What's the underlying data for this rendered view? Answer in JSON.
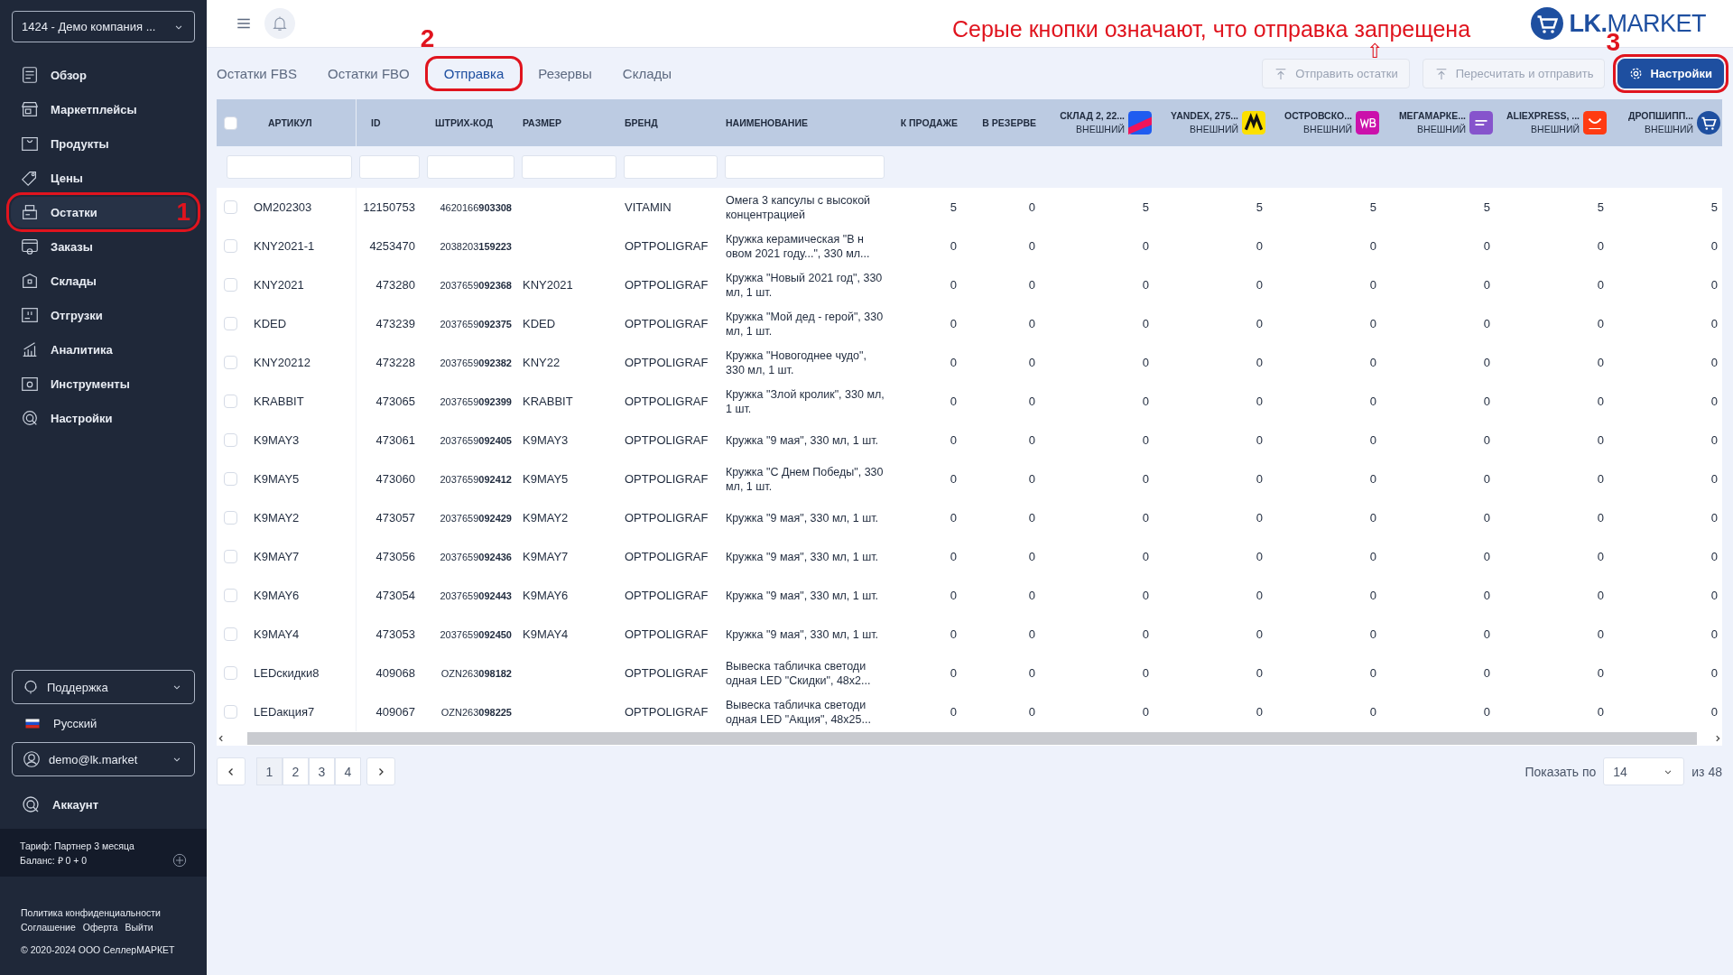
{
  "sidebar": {
    "company_select": "1424 - Демо компания ...",
    "nav": [
      {
        "label": "Обзор",
        "selected": false
      },
      {
        "label": "Маркетплейсы",
        "selected": false
      },
      {
        "label": "Продукты",
        "selected": false
      },
      {
        "label": "Цены",
        "selected": false
      },
      {
        "label": "Остатки",
        "selected": true,
        "callout": "1"
      },
      {
        "label": "Заказы",
        "selected": false
      },
      {
        "label": "Склады",
        "selected": false
      },
      {
        "label": "Отгрузки",
        "selected": false
      },
      {
        "label": "Аналитика",
        "selected": false
      },
      {
        "label": "Инструменты",
        "selected": false
      },
      {
        "label": "Настройки",
        "selected": false
      }
    ],
    "support": "Поддержка",
    "language": "Русский",
    "user": "demo@lk.market",
    "account": "Аккаунт",
    "tariff": "Тариф: Партнер 3 месяца",
    "balance": "Баланс: ₽ 0 + 0",
    "footer_links": [
      "Политика конфиденциальности",
      "Соглашение",
      "Оферта",
      "Выйти"
    ],
    "copyright": "© 2020-2024 ООО СеллерМАРКЕТ"
  },
  "header": {
    "annotation": "Серые кнопки означают, что отправка запрещена",
    "annotation_arrow": "⇧",
    "logo": "**LK.**MARKET"
  },
  "tabs": [
    {
      "label": "Остатки FBS",
      "selected": false
    },
    {
      "label": "Остатки FBO",
      "selected": false
    },
    {
      "label": "Отправка",
      "selected": true,
      "callout": "2"
    },
    {
      "label": "Резервы",
      "selected": false
    },
    {
      "label": "Склады",
      "selected": false
    }
  ],
  "actions": [
    {
      "label": "Отправить остатки",
      "disabled": true
    },
    {
      "label": "Пересчитать и отправить",
      "disabled": true
    },
    {
      "label": "Настройки",
      "disabled": false,
      "callout": "3"
    }
  ],
  "table": {
    "select_all": {
      "checked": false
    },
    "columns": [
      "АРТИКУЛ",
      "ID",
      "ШТРИХ-КОД",
      "РАЗМЕР",
      "БРЕНД",
      "НАИМЕНОВАНИЕ",
      "К ПРОДАЖЕ",
      "В РЕЗЕРВЕ"
    ],
    "marketplaces": [
      {
        "name": "СКЛАД 2, 22...",
        "type": "ВНЕШНИЙ"
      },
      {
        "name": "YANDEX, 275...",
        "type": "ВНЕШНИЙ"
      },
      {
        "name": "ОСТРОВСКО...",
        "type": "ВНЕШНИЙ"
      },
      {
        "name": "МЕГАМАРКЕ...",
        "type": "ВНЕШНИЙ"
      },
      {
        "name": "ALIEXPRESS, ...",
        "type": "ВНЕШНИЙ"
      },
      {
        "name": "ДРОПШИПП...",
        "type": "ВНЕШНИЙ"
      }
    ],
    "rows": [
      {
        "checked": false,
        "article": "OM202303",
        "id": "12150753",
        "barcode": "4620166**903308**",
        "brand": "VITAMIN",
        "name": "Омега 3 капсулы с высокой концентрацией",
        "for_sale": "5",
        "reserved": "0",
        "stock": [
          "5",
          "5",
          "5",
          "5",
          "5",
          "5"
        ]
      },
      {
        "checked": false,
        "article": "KNY2021-1",
        "id": "4253470",
        "barcode": "2038203**159223**",
        "brand": "OPTPOLIGRAF",
        "name": "Кружка керамическая \"В н овом 2021 году...\", 330 мл...",
        "for_sale": "0",
        "reserved": "0",
        "stock": [
          "0",
          "0",
          "0",
          "0",
          "0",
          "0"
        ]
      },
      {
        "checked": false,
        "article": "KNY2021",
        "id": "473280",
        "barcode": "2037659**092368**",
        "size": "KNY2021",
        "brand": "OPTPOLIGRAF",
        "name": "Кружка \"Новый 2021 год\", 330 мл, 1 шт.",
        "for_sale": "0",
        "reserved": "0",
        "stock": [
          "0",
          "0",
          "0",
          "0",
          "0",
          "0"
        ]
      },
      {
        "checked": false,
        "article": "KDED",
        "id": "473239",
        "barcode": "2037659**092375**",
        "size": "KDED",
        "brand": "OPTPOLIGRAF",
        "name": "Кружка \"Мой дед - герой\", 330 мл, 1 шт.",
        "for_sale": "0",
        "reserved": "0",
        "stock": [
          "0",
          "0",
          "0",
          "0",
          "0",
          "0"
        ]
      },
      {
        "checked": false,
        "article": "KNY20212",
        "id": "473228",
        "barcode": "2037659**092382**",
        "size": "KNY22",
        "brand": "OPTPOLIGRAF",
        "name": "Кружка \"Новогоднее чудо\", 330 мл, 1 шт.",
        "for_sale": "0",
        "reserved": "0",
        "stock": [
          "0",
          "0",
          "0",
          "0",
          "0",
          "0"
        ]
      },
      {
        "checked": false,
        "article": "KRABBIT",
        "id": "473065",
        "barcode": "2037659**092399**",
        "size": "KRABBIT",
        "brand": "OPTPOLIGRAF",
        "name": "Кружка \"Злой кролик\", 330 мл, 1 шт.",
        "for_sale": "0",
        "reserved": "0",
        "stock": [
          "0",
          "0",
          "0",
          "0",
          "0",
          "0"
        ]
      },
      {
        "checked": false,
        "article": "K9MAY3",
        "id": "473061",
        "barcode": "2037659**092405**",
        "size": "K9MAY3",
        "brand": "OPTPOLIGRAF",
        "name": "Кружка \"9 мая\", 330 мл, 1 шт.",
        "for_sale": "0",
        "reserved": "0",
        "stock": [
          "0",
          "0",
          "0",
          "0",
          "0",
          "0"
        ]
      },
      {
        "checked": false,
        "article": "K9MAY5",
        "id": "473060",
        "barcode": "2037659**092412**",
        "size": "K9MAY5",
        "brand": "OPTPOLIGRAF",
        "name": "Кружка \"С Днем Победы\", 330 мл, 1 шт.",
        "for_sale": "0",
        "reserved": "0",
        "stock": [
          "0",
          "0",
          "0",
          "0",
          "0",
          "0"
        ]
      },
      {
        "checked": false,
        "article": "K9MAY2",
        "id": "473057",
        "barcode": "2037659**092429**",
        "size": "K9MAY2",
        "brand": "OPTPOLIGRAF",
        "name": "Кружка \"9 мая\", 330 мл, 1 шт.",
        "for_sale": "0",
        "reserved": "0",
        "stock": [
          "0",
          "0",
          "0",
          "0",
          "0",
          "0"
        ]
      },
      {
        "checked": false,
        "article": "K9MAY7",
        "id": "473056",
        "barcode": "2037659**092436**",
        "size": "K9MAY7",
        "brand": "OPTPOLIGRAF",
        "name": "Кружка \"9 мая\", 330 мл, 1 шт.",
        "for_sale": "0",
        "reserved": "0",
        "stock": [
          "0",
          "0",
          "0",
          "0",
          "0",
          "0"
        ]
      },
      {
        "checked": false,
        "article": "K9MAY6",
        "id": "473054",
        "barcode": "2037659**092443**",
        "size": "K9MAY6",
        "brand": "OPTPOLIGRAF",
        "name": "Кружка \"9 мая\", 330 мл, 1 шт.",
        "for_sale": "0",
        "reserved": "0",
        "stock": [
          "0",
          "0",
          "0",
          "0",
          "0",
          "0"
        ]
      },
      {
        "checked": false,
        "article": "K9MAY4",
        "id": "473053",
        "barcode": "2037659**092450**",
        "size": "K9MAY4",
        "brand": "OPTPOLIGRAF",
        "name": "Кружка \"9 мая\", 330 мл, 1 шт.",
        "for_sale": "0",
        "reserved": "0",
        "stock": [
          "0",
          "0",
          "0",
          "0",
          "0",
          "0"
        ]
      },
      {
        "checked": false,
        "article": "LEDскидки8",
        "id": "409068",
        "barcode": "OZN263**098182**",
        "brand": "OPTPOLIGRAF",
        "name": "Вывеска табличка светоди одная LED \"Скидки\", 48x2...",
        "for_sale": "0",
        "reserved": "0",
        "stock": [
          "0",
          "0",
          "0",
          "0",
          "0",
          "0"
        ]
      },
      {
        "checked": false,
        "article": "LEDакция7",
        "id": "409067",
        "barcode": "OZN263**098225**",
        "brand": "OPTPOLIGRAF",
        "name": "Вывеска табличка светоди одная LED \"Акция\", 48x25...",
        "for_sale": "0",
        "reserved": "0",
        "stock": [
          "0",
          "0",
          "0",
          "0",
          "0",
          "0"
        ]
      }
    ]
  },
  "pagination": {
    "pages": [
      {
        "label": "1",
        "selected": true
      },
      {
        "label": "2",
        "selected": false
      },
      {
        "label": "3",
        "selected": false
      },
      {
        "label": "4",
        "selected": false
      }
    ],
    "page_size_label": "Показать по",
    "page_size": "14",
    "total": "из 48"
  }
}
